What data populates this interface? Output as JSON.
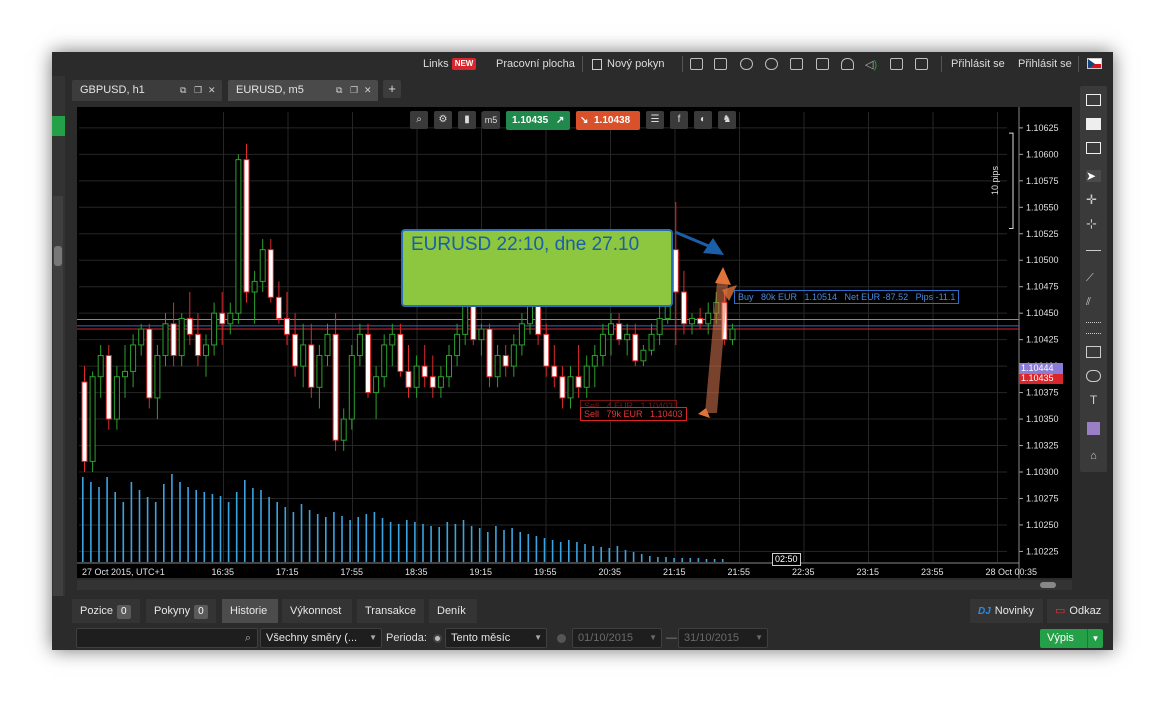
{
  "topbar": {
    "links": "Links",
    "new_badge": "NEW",
    "desktop": "Pracovní plocha",
    "new_order": "Nový pokyn",
    "login1": "Přihlásit se",
    "login2": "Přihlásit se"
  },
  "tabs": [
    {
      "label": "GBPUSD, h1",
      "active": false
    },
    {
      "label": "EURUSD, m5",
      "active": true
    }
  ],
  "toolbar": {
    "sell_price": "1.10435",
    "buy_price": "1.10438",
    "timeframe": "m5",
    "sell_color": "#1f8a4c",
    "buy_color": "#d8512a"
  },
  "chart": {
    "annotation": "EURUSD 22:10, dne 27.10",
    "annotation_color": "#8dc63f",
    "pips_label": "10 pips",
    "buy_label": "Buy   80k EUR   1.10514   Net EUR -87.52   Pips -11.1",
    "sell_label": "Sell   79k EUR   1.10403",
    "sell_label_ghost": "Sell   4 EUR   1.10403",
    "current_label": "1.10435",
    "line_label": "1.10444",
    "cursor_time": "02:50"
  },
  "chart_data": {
    "type": "candlestick",
    "symbol": "EURUSD",
    "timeframe": "m5",
    "y_ticks": [
      "1.10625",
      "1.10600",
      "1.10575",
      "1.10550",
      "1.10525",
      "1.10500",
      "1.10475",
      "1.10450",
      "1.10425",
      "1.10400",
      "1.10375",
      "1.10350",
      "1.10325",
      "1.10300",
      "1.10275",
      "1.10250",
      "1.10225"
    ],
    "x_ticks": [
      "27 Oct 2015, UTC+1",
      "16:35",
      "17:15",
      "17:55",
      "18:35",
      "19:15",
      "19:55",
      "20:35",
      "21:15",
      "21:55",
      "22:35",
      "23:15",
      "23:55",
      "28 Oct 00:35"
    ],
    "ylim": [
      1.10215,
      1.1064
    ],
    "candles": [
      [
        1.10385,
        1.104,
        1.103,
        1.1031
      ],
      [
        1.1031,
        1.10395,
        1.103,
        1.1039
      ],
      [
        1.1039,
        1.1042,
        1.1037,
        1.1041
      ],
      [
        1.1041,
        1.1042,
        1.1034,
        1.1035
      ],
      [
        1.1035,
        1.104,
        1.1034,
        1.1039
      ],
      [
        1.1039,
        1.1042,
        1.1037,
        1.10395
      ],
      [
        1.10395,
        1.1043,
        1.1038,
        1.1042
      ],
      [
        1.1042,
        1.1044,
        1.1041,
        1.10435
      ],
      [
        1.10435,
        1.1044,
        1.1036,
        1.1037
      ],
      [
        1.1037,
        1.1042,
        1.1035,
        1.1041
      ],
      [
        1.1041,
        1.1045,
        1.104,
        1.1044
      ],
      [
        1.1044,
        1.1046,
        1.104,
        1.1041
      ],
      [
        1.1041,
        1.1045,
        1.104,
        1.10445
      ],
      [
        1.10445,
        1.1047,
        1.1042,
        1.1043
      ],
      [
        1.1043,
        1.1045,
        1.104,
        1.1041
      ],
      [
        1.1041,
        1.1043,
        1.1039,
        1.1042
      ],
      [
        1.1042,
        1.1046,
        1.1041,
        1.1045
      ],
      [
        1.1045,
        1.1047,
        1.1042,
        1.1044
      ],
      [
        1.1044,
        1.1046,
        1.1043,
        1.1045
      ],
      [
        1.1045,
        1.106,
        1.1044,
        1.10595
      ],
      [
        1.10595,
        1.1061,
        1.1046,
        1.1047
      ],
      [
        1.1047,
        1.1049,
        1.1044,
        1.1048
      ],
      [
        1.1048,
        1.1052,
        1.1047,
        1.1051
      ],
      [
        1.1051,
        1.1052,
        1.1046,
        1.10465
      ],
      [
        1.10465,
        1.1048,
        1.1044,
        1.10445
      ],
      [
        1.10445,
        1.1047,
        1.1042,
        1.1043
      ],
      [
        1.1043,
        1.1045,
        1.1039,
        1.104
      ],
      [
        1.104,
        1.1044,
        1.1038,
        1.1042
      ],
      [
        1.1042,
        1.1044,
        1.1037,
        1.1038
      ],
      [
        1.1038,
        1.1042,
        1.1036,
        1.1041
      ],
      [
        1.1041,
        1.1044,
        1.104,
        1.1043
      ],
      [
        1.1043,
        1.1045,
        1.1032,
        1.1033
      ],
      [
        1.1033,
        1.1036,
        1.1032,
        1.1035
      ],
      [
        1.1035,
        1.1042,
        1.1034,
        1.1041
      ],
      [
        1.1041,
        1.1044,
        1.104,
        1.1043
      ],
      [
        1.1043,
        1.1044,
        1.1037,
        1.10375
      ],
      [
        1.10375,
        1.104,
        1.1035,
        1.1039
      ],
      [
        1.1039,
        1.1043,
        1.1038,
        1.1042
      ],
      [
        1.1042,
        1.1044,
        1.104,
        1.1043
      ],
      [
        1.1043,
        1.1044,
        1.1039,
        1.10395
      ],
      [
        1.10395,
        1.1042,
        1.1037,
        1.1038
      ],
      [
        1.1038,
        1.1041,
        1.1037,
        1.104
      ],
      [
        1.104,
        1.1042,
        1.1038,
        1.1039
      ],
      [
        1.1039,
        1.1041,
        1.1037,
        1.1038
      ],
      [
        1.1038,
        1.104,
        1.1037,
        1.1039
      ],
      [
        1.1039,
        1.1042,
        1.1038,
        1.1041
      ],
      [
        1.1041,
        1.1044,
        1.104,
        1.1043
      ],
      [
        1.1043,
        1.1047,
        1.1042,
        1.1046
      ],
      [
        1.1046,
        1.1047,
        1.1042,
        1.10425
      ],
      [
        1.10425,
        1.1044,
        1.1041,
        1.10435
      ],
      [
        1.10435,
        1.1044,
        1.1038,
        1.1039
      ],
      [
        1.1039,
        1.1042,
        1.1038,
        1.1041
      ],
      [
        1.1041,
        1.1042,
        1.1039,
        1.104
      ],
      [
        1.104,
        1.1043,
        1.1039,
        1.1042
      ],
      [
        1.1042,
        1.1045,
        1.1041,
        1.1044
      ],
      [
        1.1044,
        1.1047,
        1.1043,
        1.1046
      ],
      [
        1.1046,
        1.1047,
        1.1042,
        1.1043
      ],
      [
        1.1043,
        1.1044,
        1.1039,
        1.104
      ],
      [
        1.104,
        1.1042,
        1.1038,
        1.1039
      ],
      [
        1.1039,
        1.104,
        1.1036,
        1.1037
      ],
      [
        1.1037,
        1.104,
        1.1036,
        1.1039
      ],
      [
        1.1039,
        1.1042,
        1.1037,
        1.1038
      ],
      [
        1.1038,
        1.1041,
        1.1037,
        1.104
      ],
      [
        1.104,
        1.1042,
        1.1038,
        1.1041
      ],
      [
        1.1041,
        1.1044,
        1.104,
        1.1043
      ],
      [
        1.1043,
        1.1045,
        1.1041,
        1.1044
      ],
      [
        1.1044,
        1.1045,
        1.1042,
        1.10425
      ],
      [
        1.10425,
        1.1044,
        1.1041,
        1.1043
      ],
      [
        1.1043,
        1.1044,
        1.104,
        1.10405
      ],
      [
        1.10405,
        1.1042,
        1.104,
        1.10415
      ],
      [
        1.10415,
        1.1044,
        1.1041,
        1.1043
      ],
      [
        1.1043,
        1.1046,
        1.1042,
        1.10445
      ],
      [
        1.10445,
        1.1052,
        1.1044,
        1.1051
      ],
      [
        1.1051,
        1.10555,
        1.1042,
        1.1047
      ],
      [
        1.1047,
        1.1049,
        1.1043,
        1.1044
      ],
      [
        1.1044,
        1.1045,
        1.1043,
        1.10445
      ],
      [
        1.10445,
        1.10455,
        1.10435,
        1.1044
      ],
      [
        1.1044,
        1.1046,
        1.1043,
        1.1045
      ],
      [
        1.1045,
        1.1047,
        1.1044,
        1.1046
      ],
      [
        1.1046,
        1.1047,
        1.1042,
        1.10425
      ],
      [
        1.10425,
        1.1044,
        1.1042,
        1.10435
      ]
    ],
    "volumes": [
      85,
      80,
      75,
      85,
      70,
      60,
      80,
      72,
      65,
      60,
      78,
      88,
      80,
      75,
      72,
      70,
      68,
      66,
      60,
      70,
      82,
      74,
      72,
      65,
      60,
      55,
      50,
      58,
      52,
      48,
      45,
      50,
      46,
      42,
      45,
      48,
      50,
      44,
      40,
      38,
      42,
      40,
      38,
      36,
      35,
      40,
      38,
      42,
      36,
      34,
      30,
      36,
      32,
      34,
      30,
      28,
      26,
      24,
      22,
      20,
      22,
      20,
      18,
      16,
      15,
      14,
      16,
      12,
      10,
      8,
      6,
      5,
      5,
      4,
      4,
      4,
      4,
      3,
      3,
      3
    ],
    "horizontal_lines": [
      1.10444,
      1.10435,
      1.10438
    ],
    "grid": true
  },
  "bottom_tabs": [
    {
      "label": "Pozice",
      "count": "0"
    },
    {
      "label": "Pokyny",
      "count": "0"
    },
    {
      "label": "Historie",
      "count": ""
    },
    {
      "label": "Výkonnost",
      "count": ""
    },
    {
      "label": "Transakce",
      "count": ""
    },
    {
      "label": "Deník",
      "count": ""
    }
  ],
  "bottom_right": {
    "news": "Novinky",
    "news_prefix": "DJ",
    "feedback": "Odkaz"
  },
  "filters": {
    "direction": "Všechny směry (...",
    "period_label": "Perioda:",
    "period": "Tento měsíc",
    "date_from": "01/10/2015",
    "date_to": "31/10/2015",
    "export": "Výpis"
  }
}
